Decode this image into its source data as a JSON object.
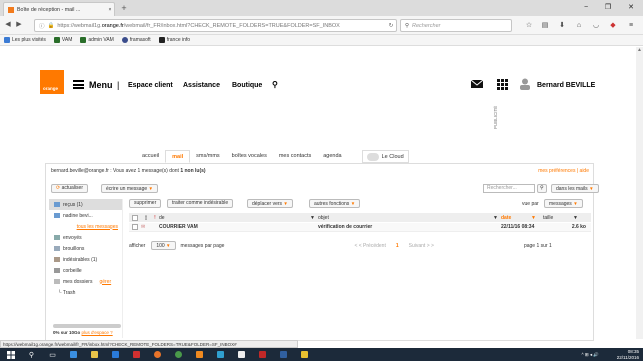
{
  "browser": {
    "tab_title": "Boîte de réception - mail ...",
    "tab_close": "×",
    "new_tab": "+",
    "win_min": "−",
    "win_max": "❐",
    "win_close": "✕",
    "url_prefix": "https://webmail1g.",
    "url_domain": "orange.fr",
    "url_rest": "/webmail/fr_FR/inbox.html?CHECK_REMOTE_FOLDERS=TRUE&FOLDER=SF_INBOX",
    "search_placeholder": "Rechercher",
    "bookmarks": [
      {
        "label": "Les plus visités",
        "color": "#3b7bd4"
      },
      {
        "label": "VAM",
        "color": "#2a6e2a"
      },
      {
        "label": "admin VAM",
        "color": "#2a6e2a"
      },
      {
        "label": "framasoft",
        "color": "#3b4d8c"
      },
      {
        "label": "france info",
        "color": "#222222"
      }
    ]
  },
  "header": {
    "logo_text": "orange",
    "menu_label": "Menu",
    "separator": "|",
    "espace_client": "Espace client",
    "assistance": "Assistance",
    "boutique": "Boutique",
    "user_name": "Bernard BEVILLE",
    "publicite": "PUBLICITÉ"
  },
  "tabs": [
    {
      "label": "accueil",
      "active": false
    },
    {
      "label": "mail",
      "active": true
    },
    {
      "label": "sms/mms",
      "active": false
    },
    {
      "label": "boîtes vocales",
      "active": false
    },
    {
      "label": "mes contacts",
      "active": false
    },
    {
      "label": "agenda",
      "active": false
    }
  ],
  "cloud_label": "Le Cloud",
  "mail": {
    "info_prefix": "bernard.beville@orange.fr : Vous avez 1 message(s) dont ",
    "info_bold": "1 non lu(s)",
    "prefs": "mes préférences | aide",
    "refresh": "actualiser",
    "write": "écrire un message",
    "search_placeholder": "Rechercher...",
    "search_scope": "dans les mails",
    "actions": {
      "delete": "supprimer",
      "spam": "traiter comme indésirable",
      "move": "déplacer vers",
      "other": "autres fonctions"
    },
    "view_label": "vue par",
    "view_value": "messages",
    "columns": {
      "from": "de",
      "subject": "objet",
      "date": "date",
      "size": "taille"
    },
    "rows": [
      {
        "from": "COURRIER VAM",
        "subject": "vérification de courrier",
        "date": "22/11/16 08:34",
        "size": "2.6 ko"
      }
    ],
    "pager": {
      "show_label": "afficher",
      "per_page_value": "100",
      "per_page_label": "messages par page",
      "prev": "< < Précédent",
      "current": "1",
      "next": "Suivant > >",
      "page_of": "page 1 sur 1"
    }
  },
  "sidebar": {
    "items": [
      {
        "label": "reçus (1)",
        "icon": "inbox-icon",
        "selected": true
      },
      {
        "label": "nadine bevi...",
        "icon": "folder-icon",
        "selected": false
      },
      {
        "label": "tous les messages",
        "icon": "",
        "selected": false,
        "link": true
      },
      {
        "label": "envoyés",
        "icon": "sent-icon",
        "selected": false
      },
      {
        "label": "brouillons",
        "icon": "draft-icon",
        "selected": false
      },
      {
        "label": "indésirables (1)",
        "icon": "spam-icon",
        "selected": false
      },
      {
        "label": "corbeille",
        "icon": "trash-icon",
        "selected": false
      },
      {
        "label": "mes dossiers",
        "icon": "folder-icon",
        "selected": false,
        "action": "gérer"
      },
      {
        "label": "└ Trash",
        "icon": "",
        "selected": false
      }
    ],
    "quota_text": "0% sur 10Go",
    "quota_link": "plus d'espace ?"
  },
  "status_url": "https://webmail1g.orange.fr/webmail/fr_FR/inbox.html?CHECK_REMOTE_FOLDERS=TRUE&FOLDER=SF_INBOX#",
  "taskbar": {
    "time": "08:35",
    "date": "22/11/2016",
    "tray": "^ ⊞ ◂ 🔊"
  },
  "colors": {
    "accent": "#ff7900",
    "taskbar": "#1c2a3a"
  }
}
